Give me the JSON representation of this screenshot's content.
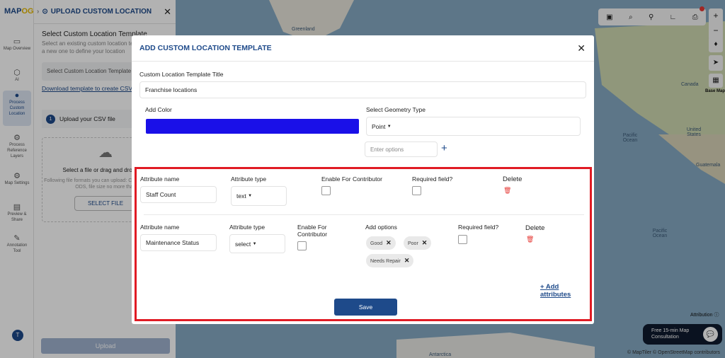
{
  "app": {
    "logo_main": "MAP",
    "logo_accent": "OG"
  },
  "rail": {
    "items": [
      {
        "icon": "map-icon",
        "label": "Map Overview"
      },
      {
        "icon": "ai-icon",
        "label": "AI"
      },
      {
        "icon": "location-pin-icon",
        "label": "Process Custom Location"
      },
      {
        "icon": "gear-icon",
        "label": "Process Reference Layers"
      },
      {
        "icon": "settings-icon",
        "label": "Map Settings"
      },
      {
        "icon": "preview-icon",
        "label": "Preview & Share"
      },
      {
        "icon": "annotation-icon",
        "label": "Annotation Tool"
      }
    ],
    "avatar": "T"
  },
  "panel": {
    "title": "UPLOAD CUSTOM LOCATION",
    "section_title": "Select Custom Location Template",
    "section_sub": "Select an existing custom location template or add a new one to define your location",
    "select_placeholder": "Select Custom Location Template",
    "download_link": "Download template to create CSV",
    "step_number": "1",
    "step_label": "Upload your CSV file",
    "drop_title": "Select a file or drag and drop here",
    "drop_sub": "Following file formats you can upload: CSV, XLSX, XLS, ODS, file size no more than",
    "select_file": "SELECT FILE",
    "upload": "Upload"
  },
  "map": {
    "labels": [
      "Greenland",
      "Canada",
      "Pacific Ocean",
      "United States",
      "Guatemala",
      "Pacific Ocean",
      "Antarctica"
    ],
    "base_map": "Base Map",
    "attribution": "Attribution",
    "consult": "Free 15-min Map Consultation",
    "copyright": "© MapTiler © OpenStreetMap contributors"
  },
  "modal": {
    "title": "ADD CUSTOM LOCATION TEMPLATE",
    "template_title_label": "Custom Location Template Title",
    "template_title_value": "Franchise locations",
    "add_color_label": "Add Color",
    "color": "#1a10e8",
    "geometry_label": "Select Geometry Type",
    "geometry_value": "Point",
    "options_placeholder": "Enter options",
    "attributes": [
      {
        "name_label": "Attribute name",
        "name": "Staff Count",
        "type_label": "Attribute type",
        "type": "text",
        "contrib_label": "Enable For Contributor",
        "required_label": "Required field?",
        "delete_label": "Delete"
      },
      {
        "name_label": "Attribute name",
        "name": "Maintenance Status",
        "type_label": "Attribute type",
        "type": "select",
        "contrib_label": "Enable For Contributor",
        "options_label": "Add options",
        "options": [
          "Good",
          "Poor",
          "Needs Repair"
        ],
        "required_label": "Required field?",
        "delete_label": "Delete"
      }
    ],
    "add_attributes": "+ Add attributes",
    "save": "Save"
  }
}
